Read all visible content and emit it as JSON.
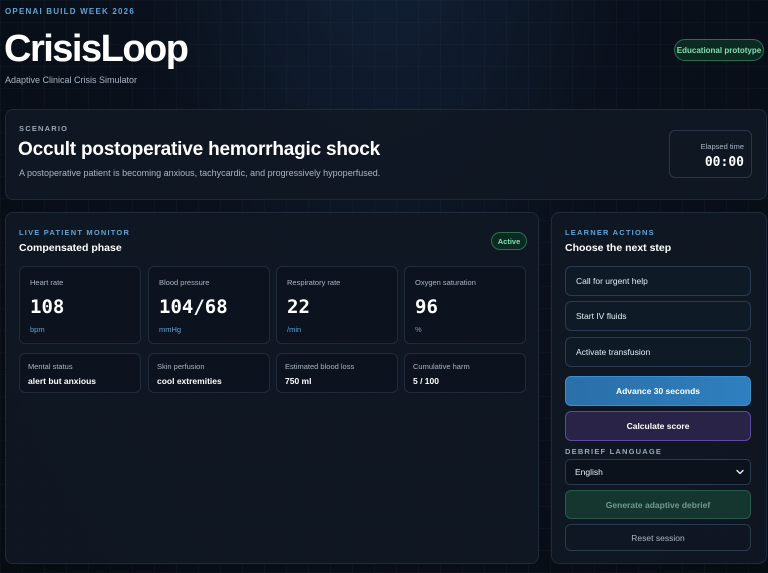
{
  "header": {
    "eyebrow": "OPENAI BUILD WEEK 2026",
    "brand": "CrisisLoop",
    "tagline": "Adaptive Clinical Crisis Simulator",
    "badge": "Educational prototype"
  },
  "scenario": {
    "label": "SCENARIO",
    "title": "Occult postoperative hemorrhagic shock",
    "description": "A postoperative patient is becoming anxious, tachycardic, and progressively hypoperfused.",
    "elapsed_label": "Elapsed time",
    "elapsed_value": "00:00"
  },
  "monitor": {
    "label": "LIVE PATIENT MONITOR",
    "phase": "Compensated phase",
    "status": "Active",
    "vitals": [
      {
        "name": "Heart rate",
        "value": "108",
        "unit": "bpm"
      },
      {
        "name": "Blood pressure",
        "value": "104/68",
        "unit": "mmHg"
      },
      {
        "name": "Respiratory rate",
        "value": "22",
        "unit": "/min"
      },
      {
        "name": "Oxygen saturation",
        "value": "96",
        "unit": "%"
      }
    ],
    "stats": [
      {
        "name": "Mental status",
        "value": "alert but anxious"
      },
      {
        "name": "Skin perfusion",
        "value": "cool extremities"
      },
      {
        "name": "Estimated blood loss",
        "value": "750 ml"
      },
      {
        "name": "Cumulative harm",
        "value": "5 / 100"
      }
    ]
  },
  "actions": {
    "label": "LEARNER ACTIONS",
    "title": "Choose the next step",
    "options": [
      "Call for urgent help",
      "Start IV fluids",
      "Activate transfusion"
    ],
    "advance": "Advance 30 seconds",
    "score": "Calculate score",
    "language_label": "DEBRIEF LANGUAGE",
    "language_value": "English",
    "debrief": "Generate adaptive debrief",
    "reset": "Reset session"
  },
  "colors": {
    "accent_blue": "#5fa3d6",
    "success_green": "#7fe0b3",
    "advance_button": "#2f7fbf",
    "score_button": "#2a2348"
  }
}
